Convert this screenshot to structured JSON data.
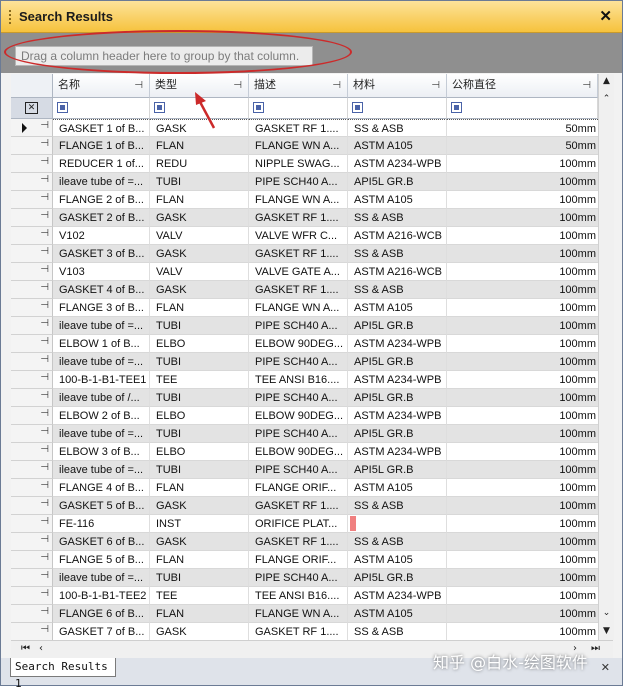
{
  "window": {
    "title": "Search Results",
    "close_glyph": "✕"
  },
  "group_panel": {
    "hint": "Drag a column header here to group by that column."
  },
  "columns": [
    "名称",
    "类型",
    "描述",
    "材料",
    "公称直径"
  ],
  "header_pin_glyph": "⊣",
  "rows": [
    {
      "name": "GASKET 1 of B...",
      "type": "GASK",
      "desc": "GASKET RF 1....",
      "material": "SS & ASB",
      "dn": "50mm",
      "current": true
    },
    {
      "name": "FLANGE 1 of B...",
      "type": "FLAN",
      "desc": "FLANGE WN A...",
      "material": "ASTM A105",
      "dn": "50mm"
    },
    {
      "name": "REDUCER 1 of...",
      "type": "REDU",
      "desc": "NIPPLE SWAG...",
      "material": "ASTM A234-WPB",
      "dn": "100mm"
    },
    {
      "name": "ileave tube of =...",
      "type": "TUBI",
      "desc": "PIPE SCH40 A...",
      "material": "API5L GR.B",
      "dn": "100mm"
    },
    {
      "name": "FLANGE 2 of B...",
      "type": "FLAN",
      "desc": "FLANGE WN A...",
      "material": "ASTM A105",
      "dn": "100mm"
    },
    {
      "name": "GASKET 2 of B...",
      "type": "GASK",
      "desc": "GASKET RF 1....",
      "material": "SS & ASB",
      "dn": "100mm"
    },
    {
      "name": "V102",
      "type": "VALV",
      "desc": "VALVE WFR C...",
      "material": "ASTM A216-WCB",
      "dn": "100mm"
    },
    {
      "name": "GASKET 3 of B...",
      "type": "GASK",
      "desc": "GASKET RF 1....",
      "material": "SS & ASB",
      "dn": "100mm"
    },
    {
      "name": "V103",
      "type": "VALV",
      "desc": "VALVE GATE A...",
      "material": "ASTM A216-WCB",
      "dn": "100mm"
    },
    {
      "name": "GASKET 4 of B...",
      "type": "GASK",
      "desc": "GASKET RF 1....",
      "material": "SS & ASB",
      "dn": "100mm"
    },
    {
      "name": "FLANGE 3 of B...",
      "type": "FLAN",
      "desc": "FLANGE WN A...",
      "material": "ASTM A105",
      "dn": "100mm"
    },
    {
      "name": "ileave tube of =...",
      "type": "TUBI",
      "desc": "PIPE SCH40 A...",
      "material": "API5L GR.B",
      "dn": "100mm"
    },
    {
      "name": "ELBOW 1 of B...",
      "type": "ELBO",
      "desc": "ELBOW 90DEG...",
      "material": "ASTM A234-WPB",
      "dn": "100mm"
    },
    {
      "name": "ileave tube of =...",
      "type": "TUBI",
      "desc": "PIPE SCH40 A...",
      "material": "API5L GR.B",
      "dn": "100mm"
    },
    {
      "name": "100-B-1-B1-TEE1",
      "type": "TEE",
      "desc": "TEE ANSI B16....",
      "material": "ASTM A234-WPB",
      "dn": "100mm"
    },
    {
      "name": "ileave tube of /...",
      "type": "TUBI",
      "desc": "PIPE SCH40 A...",
      "material": "API5L GR.B",
      "dn": "100mm"
    },
    {
      "name": "ELBOW 2 of B...",
      "type": "ELBO",
      "desc": "ELBOW 90DEG...",
      "material": "ASTM A234-WPB",
      "dn": "100mm"
    },
    {
      "name": "ileave tube of =...",
      "type": "TUBI",
      "desc": "PIPE SCH40 A...",
      "material": "API5L GR.B",
      "dn": "100mm"
    },
    {
      "name": "ELBOW 3 of B...",
      "type": "ELBO",
      "desc": "ELBOW 90DEG...",
      "material": "ASTM A234-WPB",
      "dn": "100mm"
    },
    {
      "name": "ileave tube of =...",
      "type": "TUBI",
      "desc": "PIPE SCH40 A...",
      "material": "API5L GR.B",
      "dn": "100mm"
    },
    {
      "name": "FLANGE 4 of B...",
      "type": "FLAN",
      "desc": "FLANGE ORIF...",
      "material": "ASTM A105",
      "dn": "100mm"
    },
    {
      "name": "GASKET 5 of B...",
      "type": "GASK",
      "desc": "GASKET RF 1....",
      "material": "SS & ASB",
      "dn": "100mm"
    },
    {
      "name": "FE-116",
      "type": "INST",
      "desc": "ORIFICE PLAT...",
      "material": "",
      "dn": "100mm",
      "marker": true
    },
    {
      "name": "GASKET 6 of B...",
      "type": "GASK",
      "desc": "GASKET RF 1....",
      "material": "SS & ASB",
      "dn": "100mm"
    },
    {
      "name": "FLANGE 5 of B...",
      "type": "FLAN",
      "desc": "FLANGE ORIF...",
      "material": "ASTM A105",
      "dn": "100mm"
    },
    {
      "name": "ileave tube of =...",
      "type": "TUBI",
      "desc": "PIPE SCH40 A...",
      "material": "API5L GR.B",
      "dn": "100mm"
    },
    {
      "name": "100-B-1-B1-TEE2",
      "type": "TEE",
      "desc": "TEE ANSI B16....",
      "material": "ASTM A234-WPB",
      "dn": "100mm"
    },
    {
      "name": "FLANGE 6 of B...",
      "type": "FLAN",
      "desc": "FLANGE WN A...",
      "material": "ASTM A105",
      "dn": "100mm"
    },
    {
      "name": "GASKET 7 of B...",
      "type": "GASK",
      "desc": "GASKET RF 1....",
      "material": "SS & ASB",
      "dn": "100mm"
    }
  ],
  "tab": {
    "label": "Search Results 1"
  },
  "watermark": "知乎 @白水-绘图软件",
  "colors": {
    "title_bar": "#f6c23c",
    "group_bar": "#8f8f8f",
    "annotation": "#cc2a2a",
    "marker": "#f08080"
  }
}
